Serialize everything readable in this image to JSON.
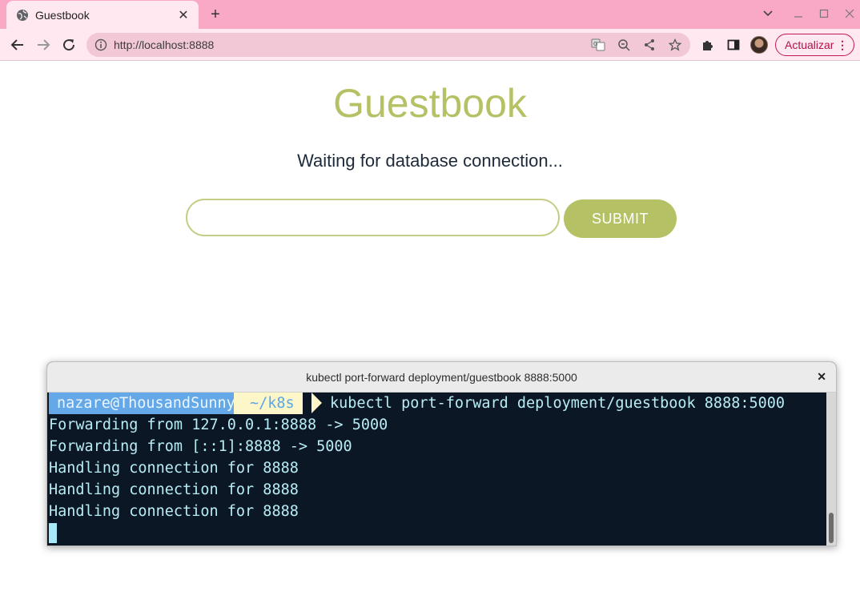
{
  "browser": {
    "tab_title": "Guestbook",
    "url": "http://localhost:8888",
    "update_label": "Actualizar",
    "accent": "#f9a8c5"
  },
  "page": {
    "title": "Guestbook",
    "status": "Waiting for database connection...",
    "input_value": "",
    "submit_label": "SUBMIT",
    "accent": "#b6c165"
  },
  "terminal": {
    "title": "kubectl port-forward deployment/guestbook 8888:5000",
    "prompt_user": "nazare@ThousandSunny",
    "prompt_dir": "~/k8s",
    "command": "kubectl port-forward deployment/guestbook 8888:5000",
    "output": [
      "Forwarding from 127.0.0.1:8888 -> 5000",
      "Forwarding from [::1]:8888 -> 5000",
      "Handling connection for 8888",
      "Handling connection for 8888",
      "Handling connection for 8888"
    ]
  }
}
